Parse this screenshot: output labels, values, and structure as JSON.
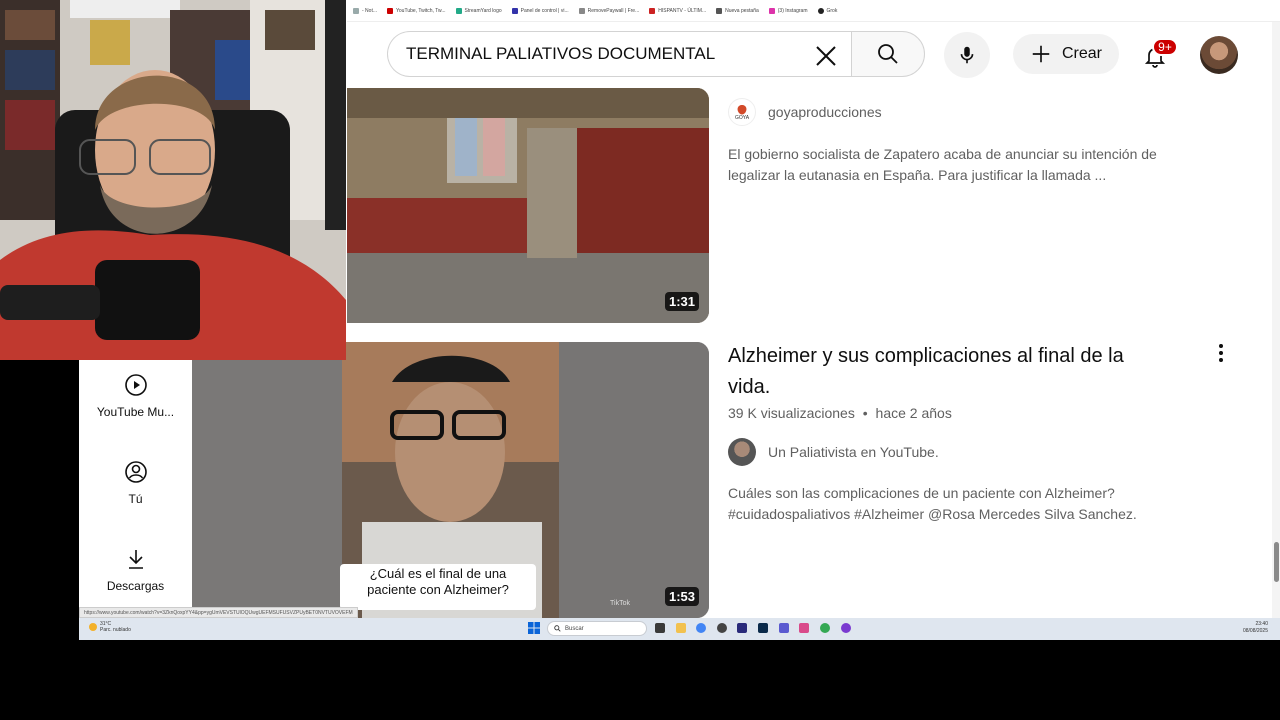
{
  "bookmarks": [
    {
      "label": "- Not...",
      "color": "#9aa"
    },
    {
      "label": "YouTube, Twitch, Tw...",
      "color": "#c00"
    },
    {
      "label": "StreamYard logo",
      "color": "#2a8"
    },
    {
      "label": "Panel de control | vi...",
      "color": "#33a"
    },
    {
      "label": "RemovePaywall | Fre...",
      "color": "#888"
    },
    {
      "label": "HISPANTV - ÚLTIM...",
      "color": "#c22"
    },
    {
      "label": "Nueva pestaña",
      "color": "#555"
    },
    {
      "label": "(3) Instagram",
      "color": "#d3a"
    },
    {
      "label": "Grok",
      "color": "#222"
    }
  ],
  "header": {
    "search_value": "TERMINAL PALIATIVOS DOCUMENTAL",
    "create_label": "Crear",
    "notifications_badge": "9+"
  },
  "sidebar": {
    "items": [
      {
        "label": "YouTube Mu...",
        "icon": "youtube-music-icon"
      },
      {
        "label": "Tú",
        "icon": "user-icon"
      },
      {
        "label": "Descargas",
        "icon": "download-icon"
      }
    ]
  },
  "results": [
    {
      "duration": "1:31",
      "channel": "goyaproducciones",
      "channel_logo_text": "GOYA",
      "description": "El gobierno socialista de Zapatero acaba de anunciar su intención de legalizar la eutanasia en España. Para justificar la llamada ..."
    },
    {
      "duration": "1:53",
      "title_line1": "Alzheimer y sus complicaciones al final de la",
      "title_line2": "vida.",
      "views": "39 K visualizaciones",
      "age": "hace 2 años",
      "channel": "Un Paliativista en YouTube.",
      "description_line1": "Cuáles son las complicaciones de un paciente con Alzheimer?",
      "description_line2": "#cuidadospaliativos #Alzheimer @Rosa Mercedes Silva Sanchez.",
      "thumb_caption_line1": "¿Cuál es el final de una",
      "thumb_caption_line2": "paciente con Alzheimer?",
      "thumb_watermark": "TikTok"
    }
  ],
  "status_url": "https://www.youtube.com/watch?v=3ZknQoxpYY4&pp=ygUmVEVSTUlOQUwgUEFMSUFUSVZPUyBET0NVTUVOVEFM",
  "taskbar": {
    "weather_temp": "31°C",
    "weather_desc": "Parc. nublado",
    "search_placeholder": "Buscar",
    "clock_time": "23:40",
    "clock_date": "08/08/2025"
  },
  "colors": {
    "badge": "#cc0000",
    "text_primary": "#0f0f0f",
    "text_secondary": "#606060"
  }
}
